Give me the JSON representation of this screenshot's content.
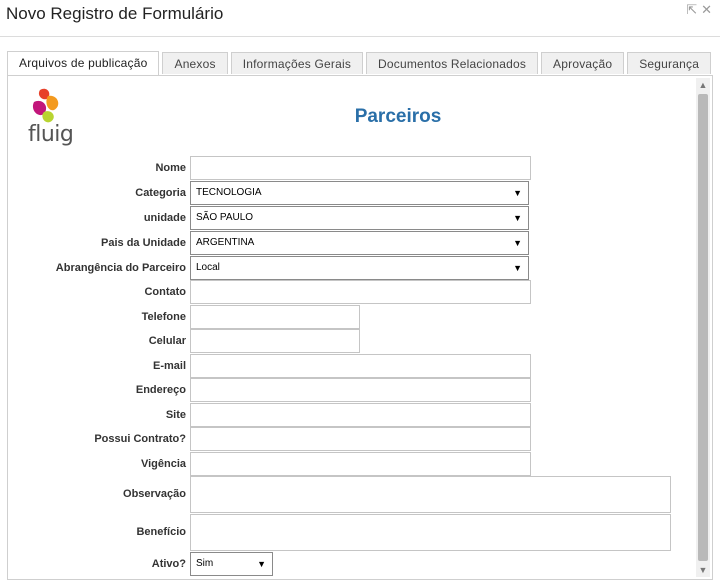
{
  "window": {
    "title": "Novo Registro de Formulário",
    "controls": [
      "⇱",
      "✕"
    ]
  },
  "tabs": [
    {
      "label": "Arquivos de publicação",
      "active": true
    },
    {
      "label": "Anexos",
      "active": false
    },
    {
      "label": "Informações Gerais",
      "active": false
    },
    {
      "label": "Documentos Relacionados",
      "active": false
    },
    {
      "label": "Aprovação",
      "active": false
    },
    {
      "label": "Segurança",
      "active": false
    }
  ],
  "logo": {
    "text": "fluig"
  },
  "form": {
    "title": "Parceiros",
    "labels": {
      "nome": "Nome",
      "categoria": "Categoria",
      "unidade": "unidade",
      "pais": "Pais da Unidade",
      "abrangencia": "Abrangência do Parceiro",
      "contato": "Contato",
      "telefone": "Telefone",
      "celular": "Celular",
      "email": "E-mail",
      "endereco": "Endereço",
      "site": "Site",
      "contrato": "Possui Contrato?",
      "vigencia": "Vigência",
      "observacao": "Observação",
      "beneficio": "Benefício",
      "ativo": "Ativo?"
    },
    "values": {
      "categoria": "TECNOLOGIA",
      "unidade": "SÃO PAULO",
      "pais": "ARGENTINA",
      "abrangencia": "Local",
      "ativo": "Sim"
    }
  },
  "colors": {
    "title": "#2a6fa8",
    "logo_accent": [
      "#e7412a",
      "#f39a1f",
      "#b8d431",
      "#c2167b"
    ]
  }
}
